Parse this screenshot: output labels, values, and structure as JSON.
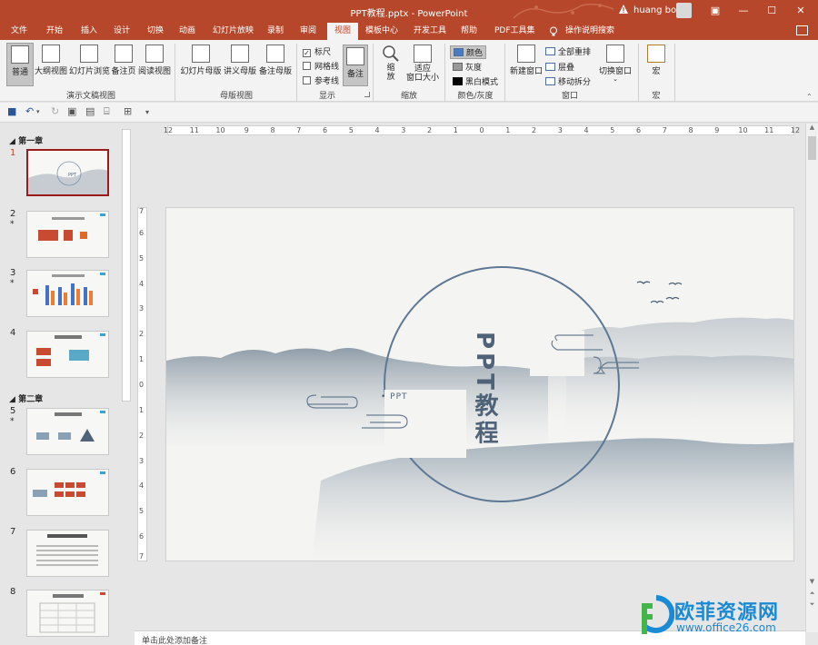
{
  "titlebar": {
    "title": "PPT教程.pptx  -  PowerPoint",
    "warning_icon": "warning-icon",
    "user": "huang bo"
  },
  "tabs": [
    "文件",
    "开始",
    "插入",
    "设计",
    "切换",
    "动画",
    "幻灯片放映",
    "录制",
    "审阅",
    "视图",
    "模板中心",
    "开发工具",
    "帮助",
    "PDF工具集",
    "操作说明搜索"
  ],
  "active_tab": "视图",
  "ribbon": {
    "presentation_views": {
      "label": "演示文稿视图",
      "items": [
        "普通",
        "大纲视图",
        "幻灯片浏览",
        "备注页",
        "阅读视图"
      ]
    },
    "master_views": {
      "label": "母版视图",
      "items": [
        "幻灯片母版",
        "讲义母版",
        "备注母版"
      ]
    },
    "show": {
      "label": "显示",
      "items": [
        {
          "label": "标尺",
          "checked": true
        },
        {
          "label": "网格线",
          "checked": false
        },
        {
          "label": "参考线",
          "checked": false
        }
      ],
      "notes": "备注"
    },
    "zoom": {
      "label": "缩放",
      "zoom": "缩\n放",
      "fit": "适应\n窗口大小"
    },
    "color": {
      "label": "颜色/灰度",
      "items": [
        "颜色",
        "灰度",
        "黑白模式"
      ]
    },
    "window": {
      "label": "窗口",
      "new": "新建窗口",
      "arrange": "全部重排",
      "cascade": "层叠",
      "move_split": "移动拆分",
      "switch": "切换窗口"
    },
    "macros": {
      "label": "宏",
      "item": "宏"
    }
  },
  "sections": [
    "第一章",
    "第二章"
  ],
  "slides": [
    {
      "num": "1",
      "star": ""
    },
    {
      "num": "2",
      "star": "*"
    },
    {
      "num": "3",
      "star": "*"
    },
    {
      "num": "4",
      "star": ""
    },
    {
      "num": "5",
      "star": "*"
    },
    {
      "num": "6",
      "star": ""
    },
    {
      "num": "7",
      "star": ""
    },
    {
      "num": "8",
      "star": ""
    }
  ],
  "ruler_h": [
    "12",
    "11",
    "10",
    "9",
    "8",
    "7",
    "6",
    "5",
    "4",
    "3",
    "2",
    "1",
    "0",
    "1",
    "2",
    "3",
    "4",
    "5",
    "6",
    "7",
    "8",
    "9",
    "10",
    "11",
    "12"
  ],
  "ruler_v": [
    "7",
    "6",
    "5",
    "4",
    "3",
    "2",
    "1",
    "0",
    "1",
    "2",
    "3",
    "4",
    "5",
    "6",
    "7"
  ],
  "main_slide": {
    "subtitle": "• PPT",
    "title": "PPT教程"
  },
  "notes_placeholder": "单击此处添加备注",
  "watermark": {
    "text": "欧菲资源网",
    "url": "www.office26.com"
  },
  "colors": {
    "accent": "#b7472a",
    "slide_line": "#5d7894",
    "title_text": "#4e6378",
    "watermark": "#1a8ad4"
  }
}
